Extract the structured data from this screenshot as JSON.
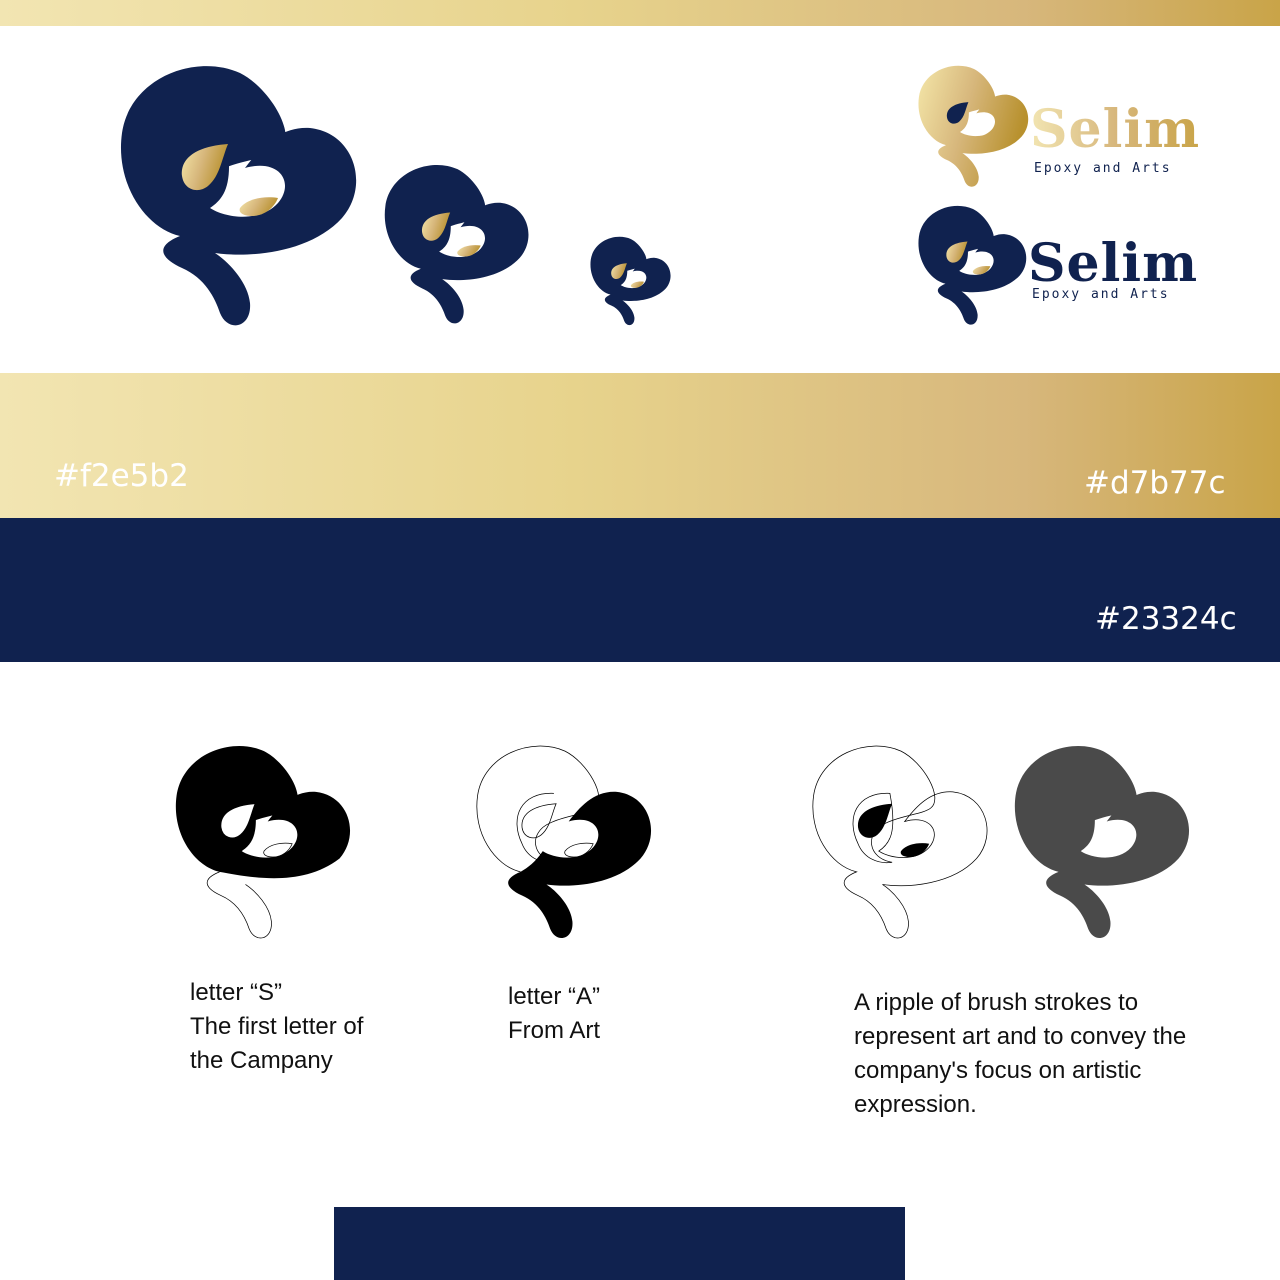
{
  "brand": {
    "name": "Selim",
    "tagline": "Epoxy and Arts"
  },
  "palette": {
    "gold_light": {
      "label": "#f2e5b2",
      "hex": "#f2e5b2"
    },
    "gold_dark": {
      "label": "#d7b77c",
      "hex": "#d7b77c"
    },
    "navy": {
      "label": "#23324c",
      "hex": "#23324c"
    }
  },
  "concepts": [
    {
      "caption": "letter “S”\nThe first letter of\n the Campany"
    },
    {
      "caption": "letter “A”\nFrom Art"
    },
    {
      "caption": "A ripple of brush strokes to\nrepresent art and to convey the\ncompany's focus on artistic\nexpression."
    }
  ],
  "icons": {
    "logo_mark": "selim-swirl-mark-icon"
  }
}
